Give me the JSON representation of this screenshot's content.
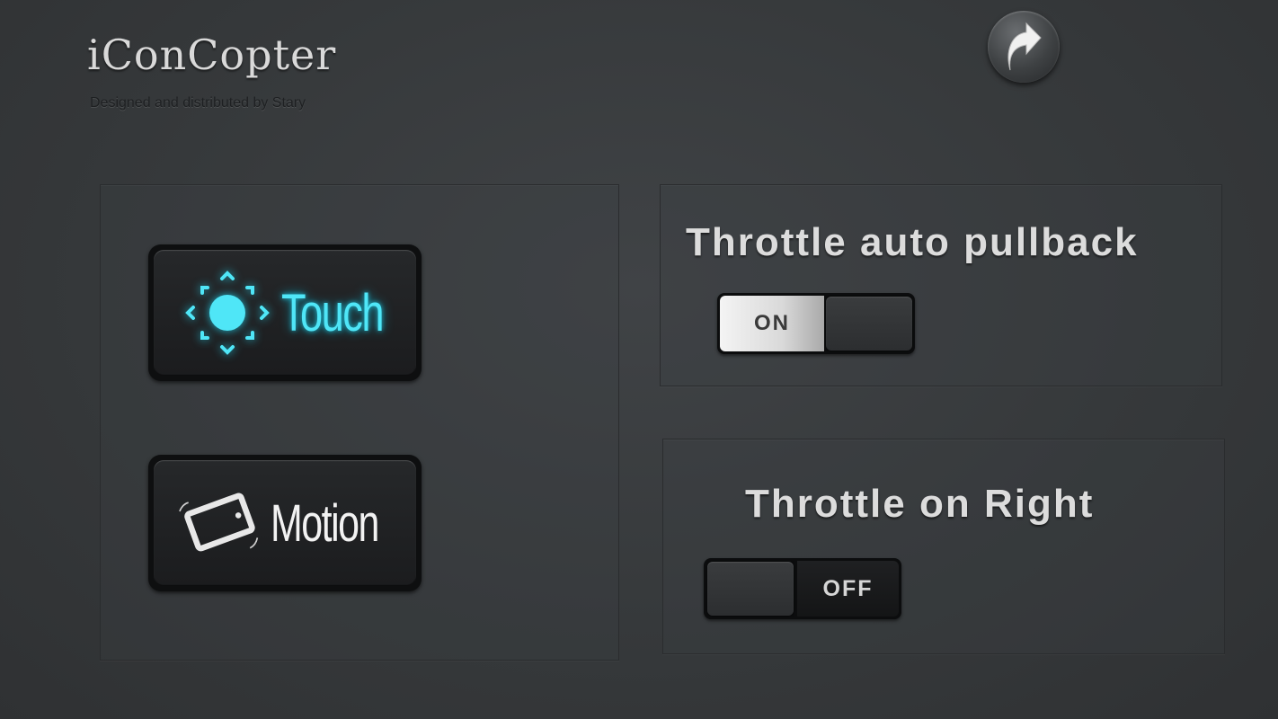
{
  "app": {
    "title": "iConCopter",
    "subtitle": "Designed and distributed by Stary",
    "back_icon": "curved-up-arrow-icon"
  },
  "control_modes": [
    {
      "label": "Touch",
      "icon": "touch-icon",
      "color": "#4fe6f7",
      "selected": true
    },
    {
      "label": "Motion",
      "icon": "phone-tilt-icon",
      "color": "#f2f2f2",
      "selected": false
    }
  ],
  "settings": {
    "throttle_pullback": {
      "title": "Throttle auto pullback",
      "state_label": "ON",
      "enabled": true
    },
    "throttle_right": {
      "title": "Throttle on Right",
      "state_label": "OFF",
      "enabled": false
    }
  }
}
